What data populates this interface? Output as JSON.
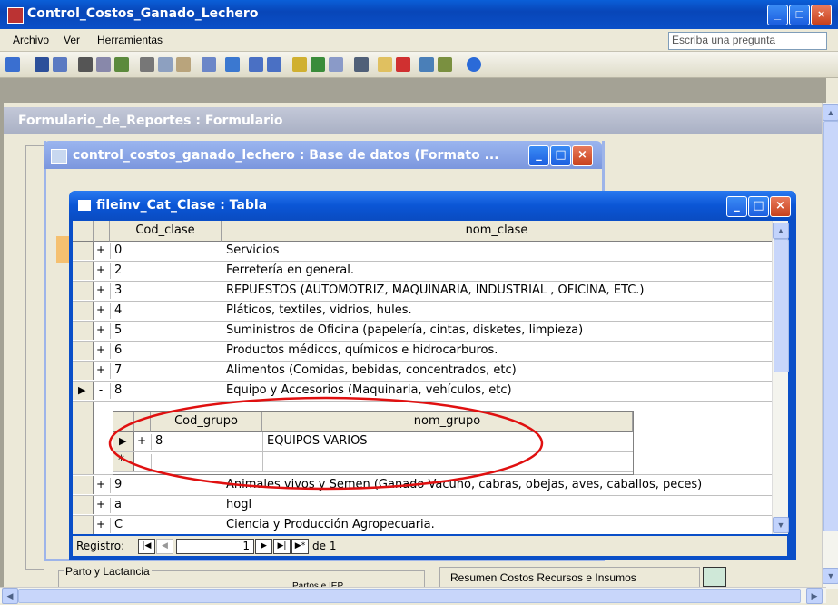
{
  "app": {
    "title": "Control_Costos_Ganado_Lechero"
  },
  "menu": {
    "items": [
      "Archivo",
      "Ver",
      "Herramientas"
    ],
    "ask_placeholder": "Escriba una pregunta"
  },
  "form_window": {
    "title": "Formulario_de_Reportes : Formulario"
  },
  "db_window": {
    "title": "control_costos_ganado_lechero : Base de datos (Formato ..."
  },
  "table_window": {
    "title": "fileinv_Cat_Clase : Tabla",
    "columns": {
      "cod": "Cod_clase",
      "nom": "nom_clase"
    },
    "rows": [
      {
        "exp": "+",
        "cod": "0",
        "nom": "Servicios"
      },
      {
        "exp": "+",
        "cod": "2",
        "nom": "Ferretería en general."
      },
      {
        "exp": "+",
        "cod": "3",
        "nom": "REPUESTOS (AUTOMOTRIZ, MAQUINARIA, INDUSTRIAL , OFICINA, ETC.)"
      },
      {
        "exp": "+",
        "cod": "4",
        "nom": "Pláticos, textiles, vidrios, hules."
      },
      {
        "exp": "+",
        "cod": "5",
        "nom": "Suministros de Oficina (papelería, cintas, disketes, limpieza)"
      },
      {
        "exp": "+",
        "cod": "6",
        "nom": "Productos médicos, químicos e hidrocarburos."
      },
      {
        "exp": "+",
        "cod": "7",
        "nom": "Alimentos (Comidas, bebidas, concentrados, etc)"
      },
      {
        "exp": "-",
        "cod": "8",
        "nom": "Equipo y Accesorios (Maquinaria, vehículos, etc)"
      },
      {
        "exp": "+",
        "cod": "9",
        "nom": "Animales vivos y Semen (Ganado Vacuno, cabras, obejas, aves, caballos, peces)"
      },
      {
        "exp": "+",
        "cod": "a",
        "nom": "hogl"
      },
      {
        "exp": "+",
        "cod": "C",
        "nom": "Ciencia y Producción Agropecuaria."
      }
    ],
    "subtable": {
      "columns": {
        "cod": "Cod_grupo",
        "nom": "nom_grupo"
      },
      "rows": [
        {
          "exp": "+",
          "cod": "8",
          "nom": "EQUIPOS VARIOS"
        }
      ],
      "new_row_marker": "*"
    },
    "navigator": {
      "label": "Registro:",
      "current": "1",
      "of_label": "de 1"
    }
  },
  "lower_form": {
    "group_label": "Parto y Lactancia",
    "partial_label": "Partos e IEP",
    "button_label": "Resumen Costos Recursos e Insumos"
  },
  "colors": {
    "annotation": "#e01010",
    "titlebar": "#0a4fc8"
  }
}
